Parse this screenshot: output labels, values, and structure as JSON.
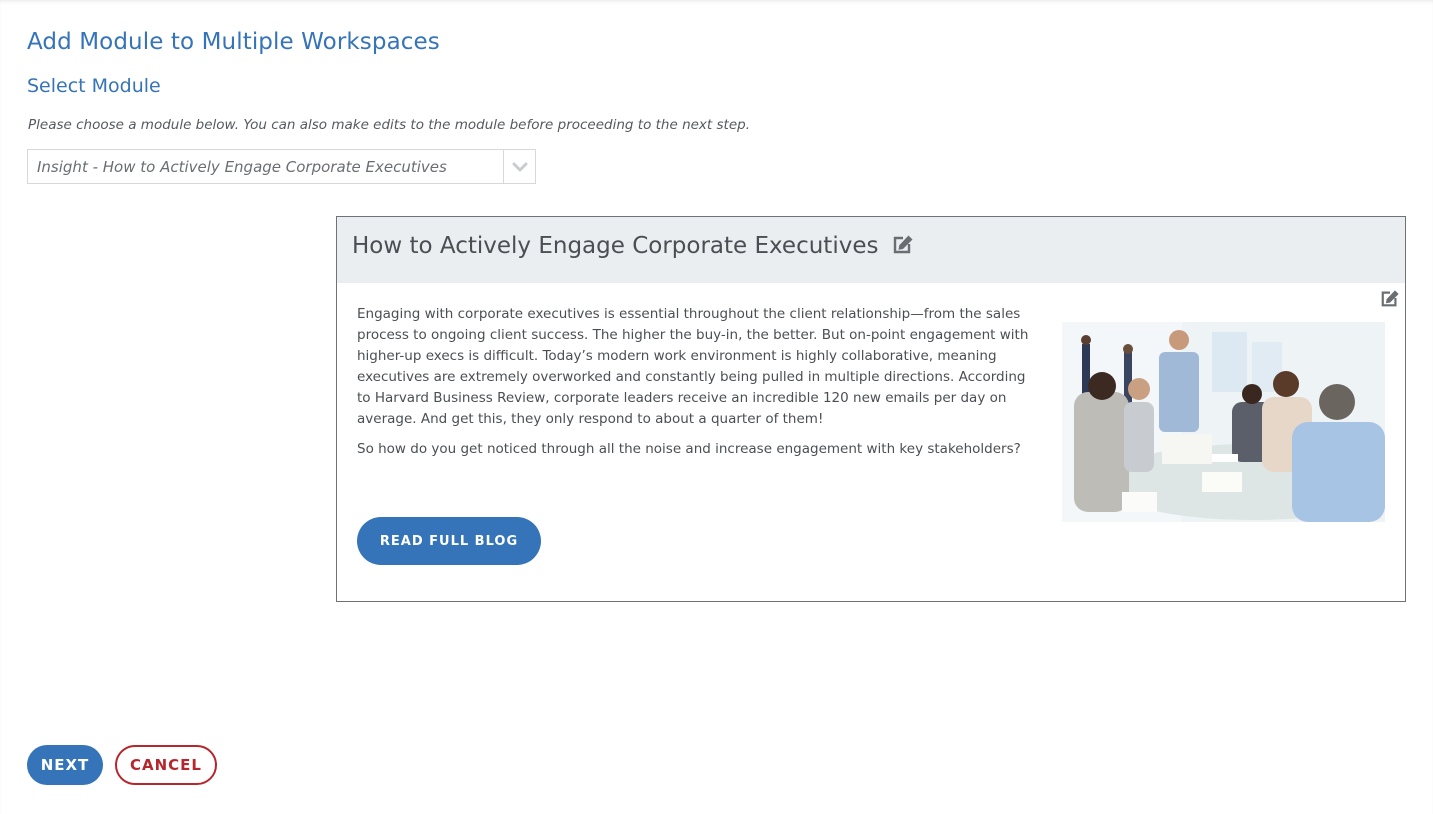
{
  "page": {
    "title": "Add Module to Multiple Workspaces",
    "section_title": "Select Module",
    "instruction": "Please choose a module below. You can also make edits to the module before proceeding to the next step."
  },
  "module_select": {
    "value": "Insight - How to Actively Engage Corporate Executives",
    "icon": "chevron-down-icon"
  },
  "preview": {
    "title": "How to Actively Engage Corporate Executives",
    "title_icon": "edit-icon",
    "body_icon": "edit-icon",
    "paragraphs": [
      "Engaging with corporate executives is essential throughout the client relationship—from the sales process to ongoing client success. The higher the buy-in, the better. But on-point engagement with higher-up execs is difficult. Today’s modern work environment is highly collaborative, meaning executives are extremely overworked and constantly being pulled in multiple directions. According to Harvard Business Review, corporate leaders receive an incredible 120 new emails per day on average. And get this, they only respond to about a quarter of them!",
      "So how do you get noticed through all the noise and increase engagement with key stakeholders?"
    ],
    "button_label": "READ FULL BLOG"
  },
  "footer": {
    "next_label": "NEXT",
    "cancel_label": "CANCEL"
  },
  "colors": {
    "primary": "#3574b8",
    "danger": "#b5272d",
    "header_bg": "#eaeef1",
    "text": "#4b4f54"
  }
}
